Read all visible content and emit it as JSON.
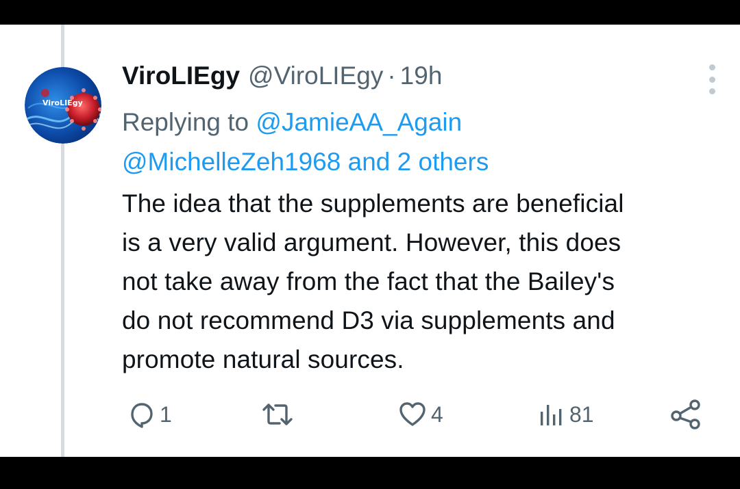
{
  "tweet": {
    "display_name": "ViroLIEgy",
    "handle": "@ViroLIEgy",
    "separator": "·",
    "time": "19h",
    "avatar_text": "ViroLIEgy",
    "replying_prefix": "Replying to",
    "reply_mention_1": "@JamieAA_Again",
    "reply_mention_2": "@MichelleZeh1968",
    "reply_and": "and",
    "reply_others": "2 others",
    "text_lines": [
      "The idea that the supplements are beneficial",
      "is a very valid argument. However, this does",
      "not take away from the fact that the Bailey's",
      "do not recommend D3 via supplements and",
      "promote natural sources."
    ]
  },
  "actions": {
    "reply_count": "1",
    "retweet_count": "",
    "like_count": "4",
    "views_count": "81"
  },
  "colors": {
    "text": "#0f1419",
    "secondary": "#536471",
    "link": "#1d9bf0",
    "thread_line": "#d6dbe0"
  },
  "icons": [
    "more-vertical-icon",
    "reply-icon",
    "retweet-icon",
    "like-icon",
    "views-icon",
    "share-icon"
  ]
}
